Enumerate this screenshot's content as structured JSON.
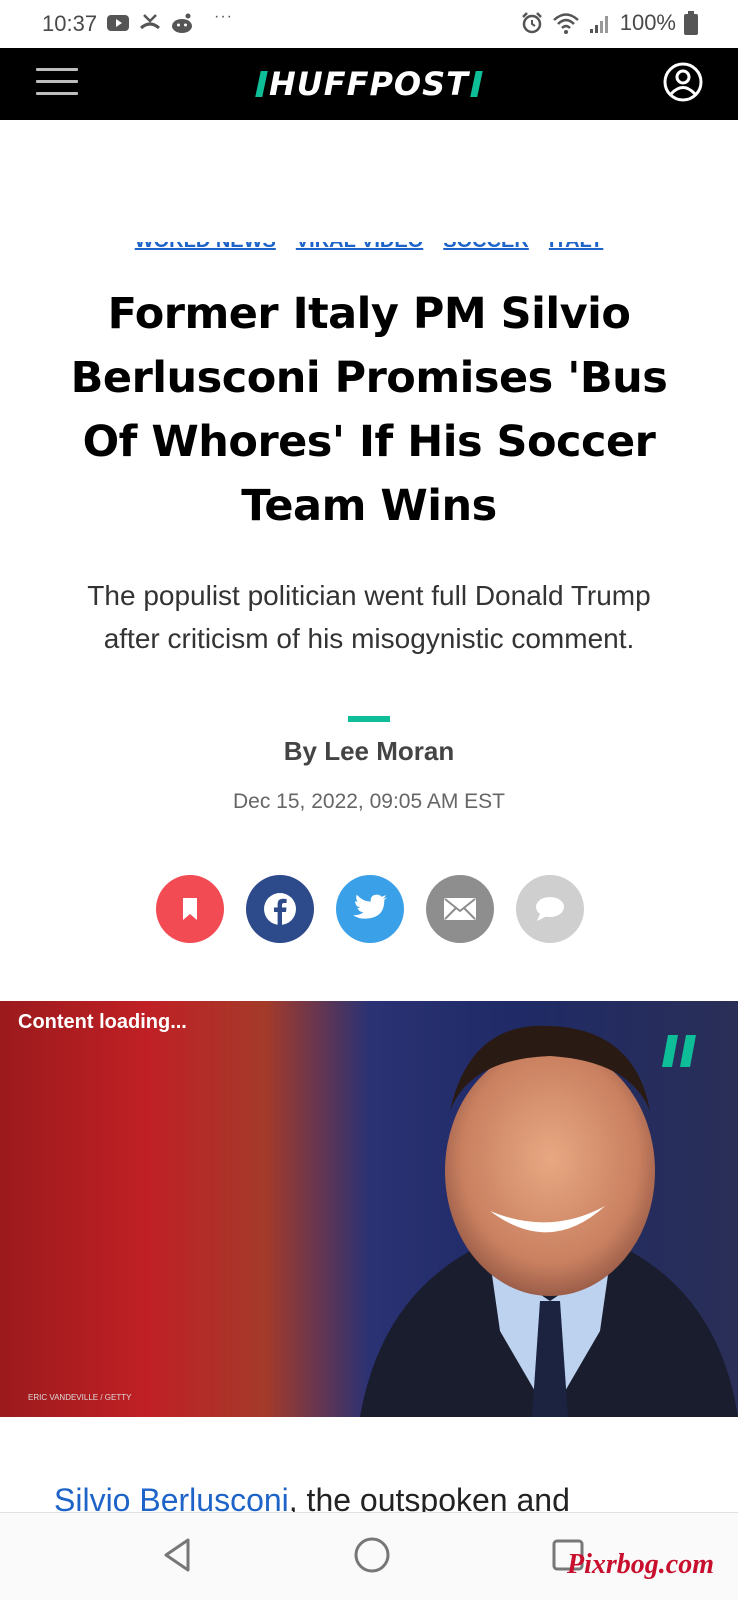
{
  "status_bar": {
    "time": "10:37",
    "more": "···",
    "battery": "100%"
  },
  "header": {
    "logo": "HUFFPOST",
    "accent_color": "#0dbe98"
  },
  "tags": [
    "World News",
    "Viral Video",
    "Soccer",
    "Italy"
  ],
  "article": {
    "headline": "Former Italy PM Silvio Berlusconi Promises 'Bus Of Whores' If His Soccer Team Wins",
    "dek": "The populist politician went full Donald Trump after criticism of his misogynistic comment.",
    "byline": "By Lee Moran",
    "date": "Dec 15, 2022, 09:05 AM EST",
    "body_link": "Silvio Berlusconi",
    "body_text": ", the outspoken and"
  },
  "share": {
    "buttons": [
      {
        "name": "bookmark",
        "icon": "bookmark-icon",
        "color": "#f24b54"
      },
      {
        "name": "facebook",
        "icon": "facebook-icon",
        "color": "#2d4a8a"
      },
      {
        "name": "twitter",
        "icon": "twitter-icon",
        "color": "#3aa0e8"
      },
      {
        "name": "email",
        "icon": "mail-icon",
        "color": "#8e8e8e"
      },
      {
        "name": "comment",
        "icon": "comment-icon",
        "color": "#cfcfcf"
      }
    ]
  },
  "video": {
    "status": "Content loading...",
    "credit": "ERIC VANDEVILLE / GETTY"
  },
  "watermark": "Pixrbog.com"
}
